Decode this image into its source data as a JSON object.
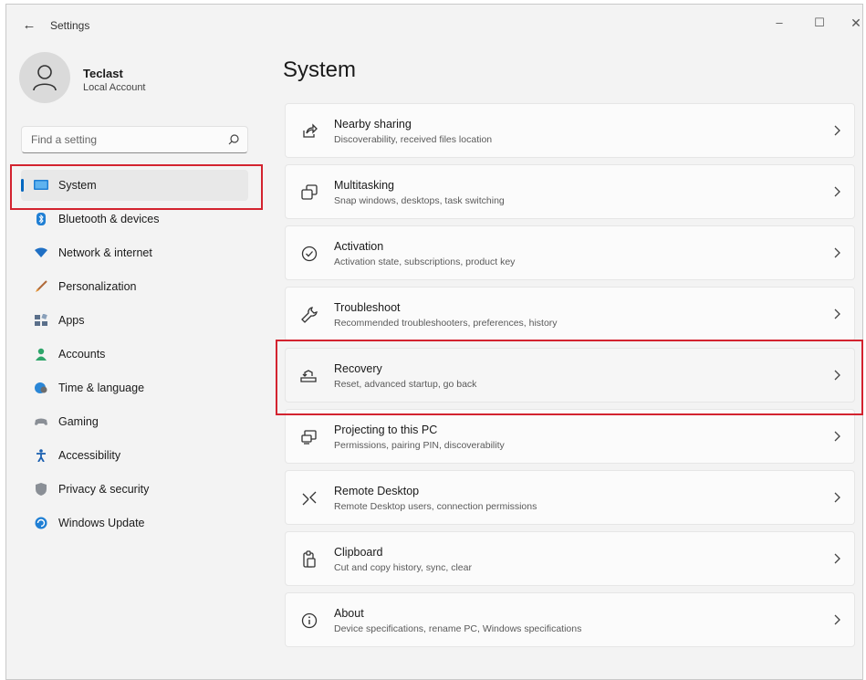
{
  "window": {
    "title": "Settings",
    "back_label": "←",
    "minimize_label": "–",
    "maximize_label": "☐",
    "close_label": "✕"
  },
  "profile": {
    "name": "Teclast",
    "account_type": "Local Account"
  },
  "search": {
    "placeholder": "Find a setting"
  },
  "sidebar": {
    "items": [
      {
        "label": "System",
        "icon": "monitor-icon",
        "selected": true
      },
      {
        "label": "Bluetooth & devices",
        "icon": "bluetooth-icon"
      },
      {
        "label": "Network & internet",
        "icon": "wifi-icon"
      },
      {
        "label": "Personalization",
        "icon": "brush-icon"
      },
      {
        "label": "Apps",
        "icon": "apps-icon"
      },
      {
        "label": "Accounts",
        "icon": "person-icon"
      },
      {
        "label": "Time & language",
        "icon": "globe-clock-icon"
      },
      {
        "label": "Gaming",
        "icon": "gamepad-icon"
      },
      {
        "label": "Accessibility",
        "icon": "accessibility-icon"
      },
      {
        "label": "Privacy & security",
        "icon": "shield-icon"
      },
      {
        "label": "Windows Update",
        "icon": "update-icon"
      }
    ]
  },
  "main": {
    "title": "System",
    "cards": [
      {
        "title": "Nearby sharing",
        "desc": "Discoverability, received files location",
        "icon": "share-icon"
      },
      {
        "title": "Multitasking",
        "desc": "Snap windows, desktops, task switching",
        "icon": "multitask-icon"
      },
      {
        "title": "Activation",
        "desc": "Activation state, subscriptions, product key",
        "icon": "check-circle-icon"
      },
      {
        "title": "Troubleshoot",
        "desc": "Recommended troubleshooters, preferences, history",
        "icon": "wrench-icon"
      },
      {
        "title": "Recovery",
        "desc": "Reset, advanced startup, go back",
        "icon": "recovery-icon"
      },
      {
        "title": "Projecting to this PC",
        "desc": "Permissions, pairing PIN, discoverability",
        "icon": "projector-icon"
      },
      {
        "title": "Remote Desktop",
        "desc": "Remote Desktop users, connection permissions",
        "icon": "remote-desktop-icon"
      },
      {
        "title": "Clipboard",
        "desc": "Cut and copy history, sync, clear",
        "icon": "clipboard-icon"
      },
      {
        "title": "About",
        "desc": "Device specifications, rename PC, Windows specifications",
        "icon": "info-icon"
      }
    ]
  },
  "colors": {
    "accent": "#0067c0",
    "highlight": "#d3232f",
    "window_bg": "#f3f3f3",
    "card_bg": "#fbfbfb"
  }
}
